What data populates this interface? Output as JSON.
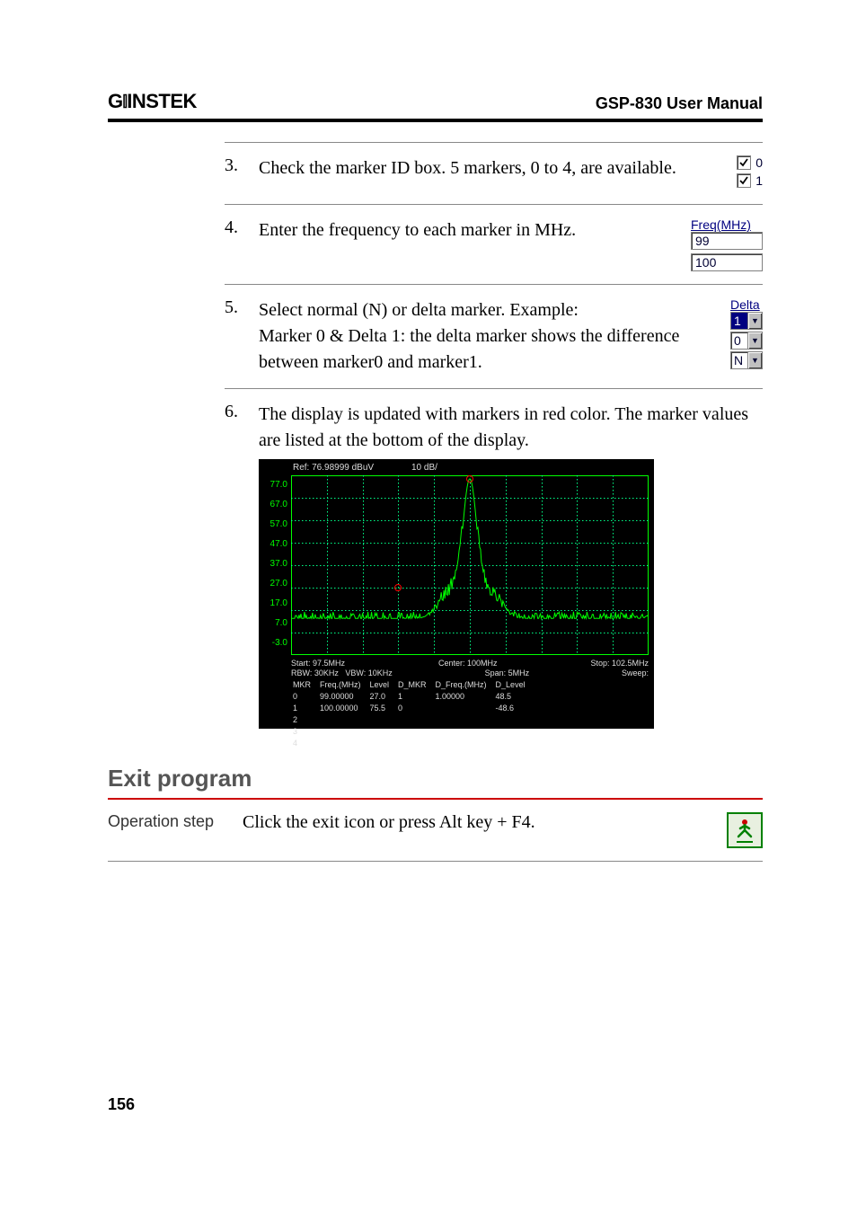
{
  "header": {
    "logo": "GWINSTEK",
    "manual": "GSP-830 User Manual"
  },
  "steps": {
    "s3": {
      "num": "3.",
      "text": "Check the marker ID box. 5 markers, 0 to 4, are available.",
      "cb0": "0",
      "cb1": "1"
    },
    "s4": {
      "num": "4.",
      "text": "Enter the frequency to each marker in MHz.",
      "label": "Freq(MHz)",
      "v0": "99",
      "v1": "100"
    },
    "s5": {
      "num": "5.",
      "text": "Select normal (N) or delta marker. Example:\nMarker 0 & Delta 1: the delta marker shows the difference between marker0 and marker1.",
      "label": "Delta",
      "sel0": "1",
      "sel1": "0",
      "sel2": "N"
    },
    "s6": {
      "num": "6.",
      "text": "The display is updated with markers in red color. The marker values are listed at the bottom of the display."
    }
  },
  "chart_data": {
    "type": "line",
    "title": "",
    "ref_label": "Ref: 76.98999 dBuV",
    "db_label": "10 dB/",
    "ylabels": [
      "77.0",
      "67.0",
      "57.0",
      "47.0",
      "37.0",
      "27.0",
      "17.0",
      "7.0",
      "-3.0"
    ],
    "ylim": [
      -3.0,
      77.0
    ],
    "xlabel": "MHz",
    "x_start": 97.5,
    "x_center": 100.0,
    "x_stop": 102.5,
    "footer": {
      "start": "Start: 97.5MHz",
      "center": "Center: 100MHz",
      "stop": "Stop: 102.5MHz",
      "rbw": "RBW: 30KHz",
      "vbw": "VBW: 10KHz",
      "span": "Span: 5MHz",
      "sweep": "Sweep:"
    },
    "marker_table": {
      "cols": [
        "MKR",
        "Freq.(MHz)",
        "Level",
        "D_MKR",
        "D_Freq.(MHz)",
        "D_Level"
      ],
      "rows": [
        [
          "0",
          "99.00000",
          "27.0",
          "1",
          "1.00000",
          "48.5"
        ],
        [
          "1",
          "100.00000",
          "75.5",
          "0",
          "",
          "-48.6"
        ],
        [
          "2",
          "",
          "",
          "",
          "",
          ""
        ],
        [
          "3",
          "",
          "",
          "",
          "",
          ""
        ],
        [
          "4",
          "",
          "",
          "",
          "",
          ""
        ]
      ]
    },
    "markers": [
      {
        "id": 0,
        "x": 99.0,
        "y": 27.0
      },
      {
        "id": 1,
        "x": 100.0,
        "y": 75.5
      }
    ],
    "noise_floor_dBuV": 13.0,
    "peak": {
      "x": 100.0,
      "y": 75.5,
      "width_mhz": 0.25
    }
  },
  "exit": {
    "title": "Exit program",
    "op_label": "Operation step",
    "op_text": "Click the exit icon or press Alt key + F4."
  },
  "page_number": "156"
}
